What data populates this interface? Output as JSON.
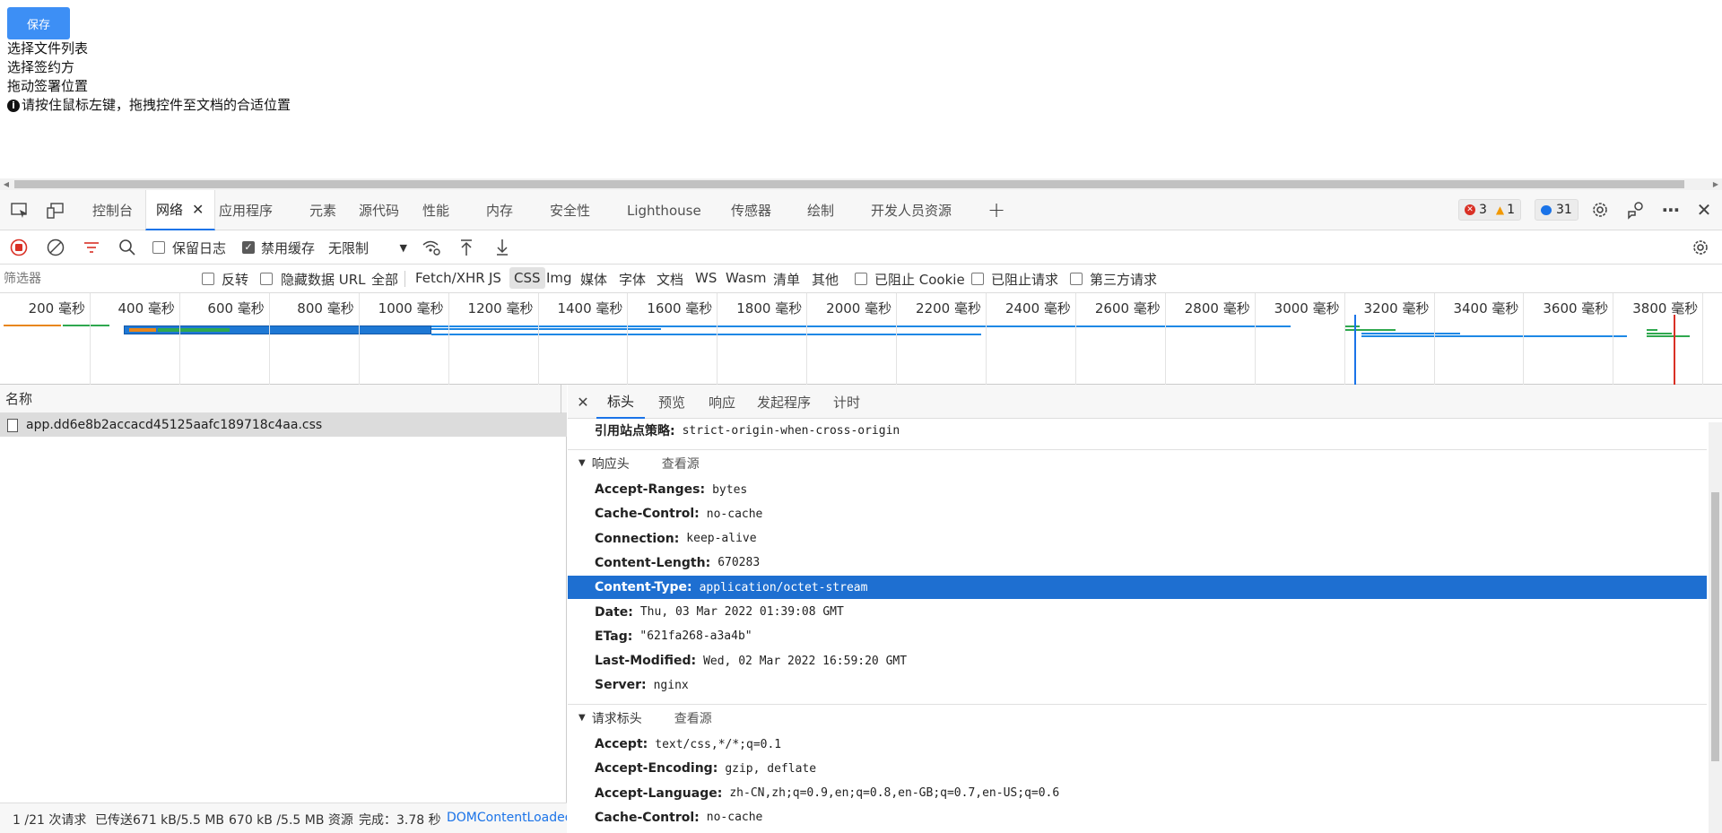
{
  "page": {
    "save_button": "保存",
    "lines": [
      "选择文件列表",
      "选择签约方",
      "拖动签署位置"
    ],
    "hint_icon": "info-circle-icon",
    "hint": "请按住鼠标左键，拖拽控件至文档的合适位置"
  },
  "devtools_tabs": {
    "inspect_icon": "inspect-element-icon",
    "device_icon": "device-emulation-icon",
    "items": [
      "控制台",
      "网络",
      "应用程序",
      "元素",
      "源代码",
      "性能",
      "内存",
      "安全性",
      "Lighthouse",
      "传感器",
      "绘制",
      "开发人员资源"
    ],
    "active": "网络",
    "add_icon": "plus-icon",
    "errors": "3",
    "warnings": "1",
    "messages": "31",
    "settings_icon": "gear-icon",
    "feedback_icon": "feedback-icon",
    "more_icon": "more-icon",
    "close_icon": "close-icon"
  },
  "toolbar": {
    "record_icon": "record-stop-icon",
    "clear_icon": "clear-icon",
    "filter_icon": "filter-icon",
    "search_icon": "search-icon",
    "preserve_log": "保留日志",
    "preserve_log_checked": false,
    "disable_cache": "禁用缓存",
    "disable_cache_checked": true,
    "throttle": "无限制",
    "wifi_icon": "network-conditions-icon",
    "upload_icon": "import-har-icon",
    "download_icon": "export-har-icon",
    "settings_icon": "gear-icon"
  },
  "filterbar": {
    "placeholder": "筛选器",
    "invert": "反转",
    "hide_data_url": "隐藏数据 URL",
    "types": [
      "全部",
      "Fetch/XHR",
      "JS",
      "CSS",
      "Img",
      "媒体",
      "字体",
      "文档",
      "WS",
      "Wasm",
      "清单",
      "其他"
    ],
    "active_type": "CSS",
    "blocked_cookie": "已阻止 Cookie",
    "blocked_requests": "已阻止请求",
    "third_party": "第三方请求"
  },
  "overview": {
    "ticks": [
      "200 毫秒",
      "400 毫秒",
      "600 毫秒",
      "800 毫秒",
      "1000 毫秒",
      "1200 毫秒",
      "1400 毫秒",
      "1600 毫秒",
      "1800 毫秒",
      "2000 毫秒",
      "2200 毫秒",
      "2400 毫秒",
      "2600 毫秒",
      "2800 毫秒",
      "3000 毫秒",
      "3200 毫秒",
      "3400 毫秒",
      "3600 毫秒",
      "3800 毫秒"
    ]
  },
  "requests": {
    "column_name": "名称",
    "file_icon": "file-icon",
    "items": [
      "app.dd6e8b2accacd45125aafc189718c4aa.css"
    ]
  },
  "status": {
    "requests": "1 /21 次请求",
    "transferred": "已传送671 kB/5.5 MB",
    "resources": "670 kB /5.5 MB 资源",
    "finish": "完成：3.78 秒",
    "dom": "DOMContentLoaded"
  },
  "details": {
    "close_icon": "close-icon",
    "tabs": [
      "标头",
      "预览",
      "响应",
      "发起程序",
      "计时"
    ],
    "active_tab": "标头",
    "referrer": {
      "key": "引用站点策略:",
      "value": "strict-origin-when-cross-origin"
    },
    "response_section": "响应头",
    "response_view_source": "查看源",
    "response_headers": [
      {
        "key": "Accept-Ranges:",
        "value": "bytes"
      },
      {
        "key": "Cache-Control:",
        "value": "no-cache"
      },
      {
        "key": "Connection:",
        "value": "keep-alive"
      },
      {
        "key": "Content-Length:",
        "value": "670283"
      },
      {
        "key": "Content-Type:",
        "value": "application/octet-stream"
      },
      {
        "key": "Date:",
        "value": "Thu, 03 Mar 2022 01:39:08 GMT"
      },
      {
        "key": "ETag:",
        "value": "\"621fa268-a3a4b\""
      },
      {
        "key": "Last-Modified:",
        "value": "Wed, 02 Mar 2022 16:59:20 GMT"
      },
      {
        "key": "Server:",
        "value": "nginx"
      }
    ],
    "highlighted": "Content-Type:",
    "request_section": "请求标头",
    "request_view_source": "查看源",
    "request_headers": [
      {
        "key": "Accept:",
        "value": "text/css,*/*;q=0.1"
      },
      {
        "key": "Accept-Encoding:",
        "value": "gzip, deflate"
      },
      {
        "key": "Accept-Language:",
        "value": "zh-CN,zh;q=0.9,en;q=0.8,en-GB;q=0.7,en-US;q=0.6"
      },
      {
        "key": "Cache-Control:",
        "value": "no-cache"
      }
    ]
  },
  "colors": {
    "accent": "#1a73e8",
    "selected_row": "#1e6fd1",
    "save_button": "#3d8ff5",
    "error": "#d93025",
    "warning": "#f29900"
  }
}
